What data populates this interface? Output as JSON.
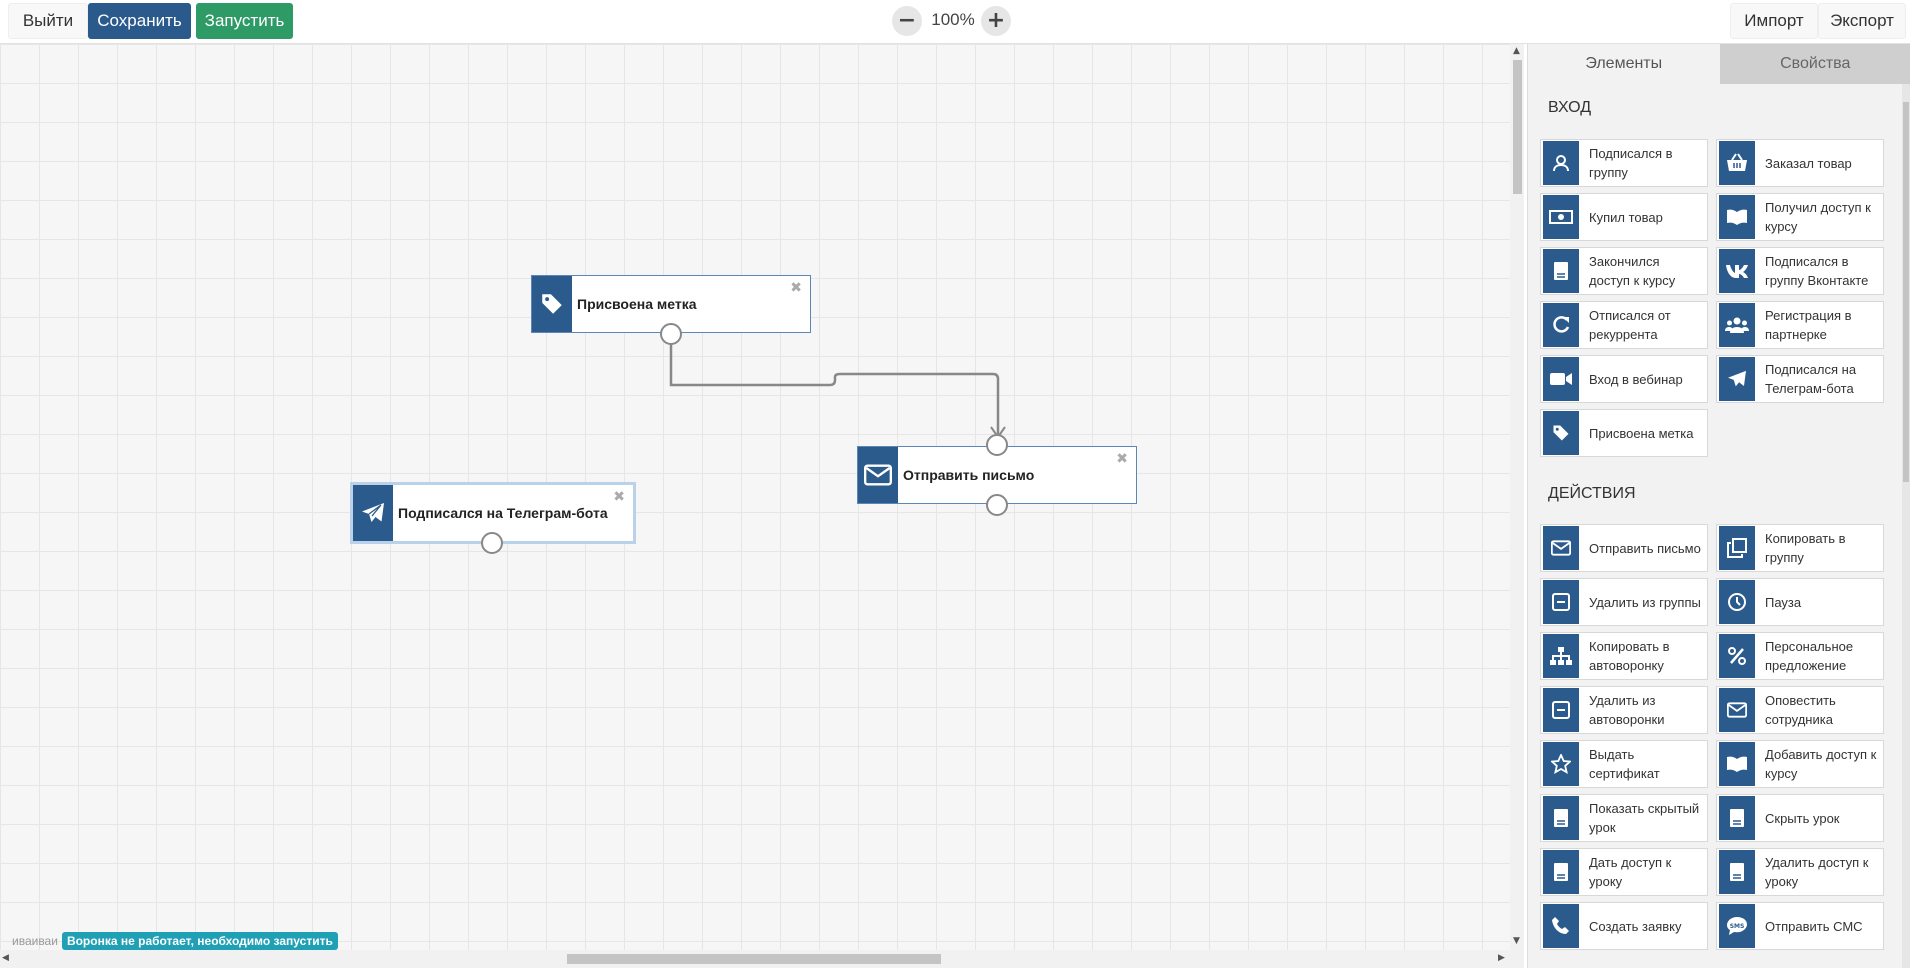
{
  "toolbar": {
    "exit_label": "Выйти",
    "save_label": "Сохранить",
    "run_label": "Запустить",
    "zoom_out_glyph": "−",
    "zoom_level": "100%",
    "zoom_in_glyph": "+",
    "import_label": "Импорт",
    "export_label": "Экспорт"
  },
  "canvas": {
    "nodes": [
      {
        "label": "Присвоена метка",
        "icon": "tag-icon"
      },
      {
        "label": "Отправить письмо",
        "icon": "envelope-icon"
      },
      {
        "label": "Подписался на Телеграм-бота",
        "icon": "telegram-icon"
      }
    ],
    "close_glyph": "✖"
  },
  "status": {
    "funnel_name": "иваиваи",
    "badge": "Воронка не работает, необходимо запустить"
  },
  "panel": {
    "tabs": [
      {
        "label": "Элементы",
        "active": true
      },
      {
        "label": "Свойства",
        "active": false
      }
    ],
    "sections": [
      {
        "title": "ВХОД",
        "items": [
          {
            "label": "Подписался в группу",
            "icon": "user-icon"
          },
          {
            "label": "Заказал товар",
            "icon": "basket-icon"
          },
          {
            "label": "Купил товар",
            "icon": "money-icon"
          },
          {
            "label": "Получил доступ к курсу",
            "icon": "book-icon"
          },
          {
            "label": "Закончился доступ к курсу",
            "icon": "lesson-icon"
          },
          {
            "label": "Подписался в группу Вконтакте",
            "icon": "vk-icon"
          },
          {
            "label": "Отписался от рекуррента",
            "icon": "refresh-icon"
          },
          {
            "label": "Регистрация в партнерке",
            "icon": "users-icon"
          },
          {
            "label": "Вход в вебинар",
            "icon": "video-icon"
          },
          {
            "label": "Подписался на Телеграм-бота",
            "icon": "telegram-icon"
          },
          {
            "label": "Присвоена метка",
            "icon": "tag-icon"
          }
        ]
      },
      {
        "title": "ДЕЙСТВИЯ",
        "items": [
          {
            "label": "Отправить письмо",
            "icon": "envelope-icon"
          },
          {
            "label": "Копировать в группу",
            "icon": "copy-icon"
          },
          {
            "label": "Удалить из группы",
            "icon": "minus-square-icon"
          },
          {
            "label": "Пауза",
            "icon": "clock-icon"
          },
          {
            "label": "Копировать в автоворонку",
            "icon": "sitemap-icon"
          },
          {
            "label": "Персональное предложение",
            "icon": "percent-icon"
          },
          {
            "label": "Удалить из автоворонки",
            "icon": "minus-square-icon"
          },
          {
            "label": "Оповестить сотрудника",
            "icon": "envelope-icon"
          },
          {
            "label": "Выдать сертификат",
            "icon": "star-icon"
          },
          {
            "label": "Добавить доступ к курсу",
            "icon": "book-icon"
          },
          {
            "label": "Показать скрытый урок",
            "icon": "lesson-icon"
          },
          {
            "label": "Скрыть урок",
            "icon": "lesson-icon"
          },
          {
            "label": "Дать доступ к уроку",
            "icon": "lesson-icon"
          },
          {
            "label": "Удалить доступ к уроку",
            "icon": "lesson-icon"
          },
          {
            "label": "Создать заявку",
            "icon": "phone-icon"
          },
          {
            "label": "Отправить СМС",
            "icon": "sms-icon"
          }
        ]
      }
    ]
  },
  "colors": {
    "save": "#2a5a8c",
    "run": "#2e9a66",
    "node_icon_bg": "#2b5b8d",
    "status_badge": "#1fa0b5"
  }
}
